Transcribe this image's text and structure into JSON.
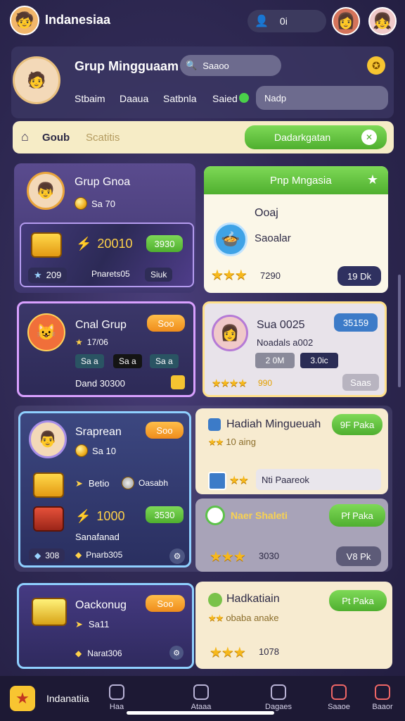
{
  "topbar": {
    "title": "Indanesiaa",
    "user_badge": "0i"
  },
  "profile": {
    "title": "Grup Mingguaam",
    "search_placeholder": "Saaoo",
    "tabs": [
      "Stbaim",
      "Daaua",
      "Satbnla",
      "Saied"
    ],
    "search2_placeholder": "Nadp"
  },
  "banner": {
    "label": "Goub",
    "sublabel": "Scatitis",
    "button": "Dadarkgatan"
  },
  "card1": {
    "title": "Grup Gnoa",
    "coins": "Sa 70",
    "amount": "20010",
    "price": "3930",
    "count": "209",
    "label": "Pnarets05",
    "sub": "Siuk"
  },
  "card2": {
    "header": "Pnp Mngasia",
    "line1": "Ooaj",
    "line2": "Saoalar",
    "score": "7290",
    "button": "19 Dk"
  },
  "card3": {
    "title": "Cnal Grup",
    "button": "Soo",
    "stars_label": "17/06",
    "chips": [
      "Sa a",
      "Sa a",
      "Sa a"
    ],
    "footer": "Dand 30300"
  },
  "card4": {
    "title": "Sua 0025",
    "badge": "35159",
    "line1": "Noadals a002",
    "chip1": "2 0M",
    "chip2": "3.0ic",
    "score": "990",
    "btn": "Saas"
  },
  "card5": {
    "title": "Sraprean",
    "button": "Soo",
    "coins": "Sa 10",
    "item1": "Betio",
    "item2": "Oasabh",
    "amount": "1000",
    "price": "3530",
    "label": "Sanafanad",
    "count": "308",
    "sub": "Pnarb305"
  },
  "card6": {
    "title": "Hadiah Mingueuah",
    "button": "9F Paka",
    "subline": "10 aing",
    "input": "Nti Paareok"
  },
  "card7": {
    "title": "Naer Shaleti",
    "button": "Pf Paka",
    "score": "3030",
    "btn": "V8 Pk"
  },
  "card8": {
    "title": "Oackonug",
    "button": "Soo",
    "coins": "Sa11",
    "label": "Narat306"
  },
  "card9": {
    "title": "Hadkatiain",
    "button": "Pt Paka",
    "subline": "obaba anake",
    "score": "1078"
  },
  "bottomnav": {
    "label": "Indanatiia",
    "items": [
      "Haa",
      "Ataaa",
      "Dagaes",
      "Saaoe",
      "Baaor"
    ]
  }
}
